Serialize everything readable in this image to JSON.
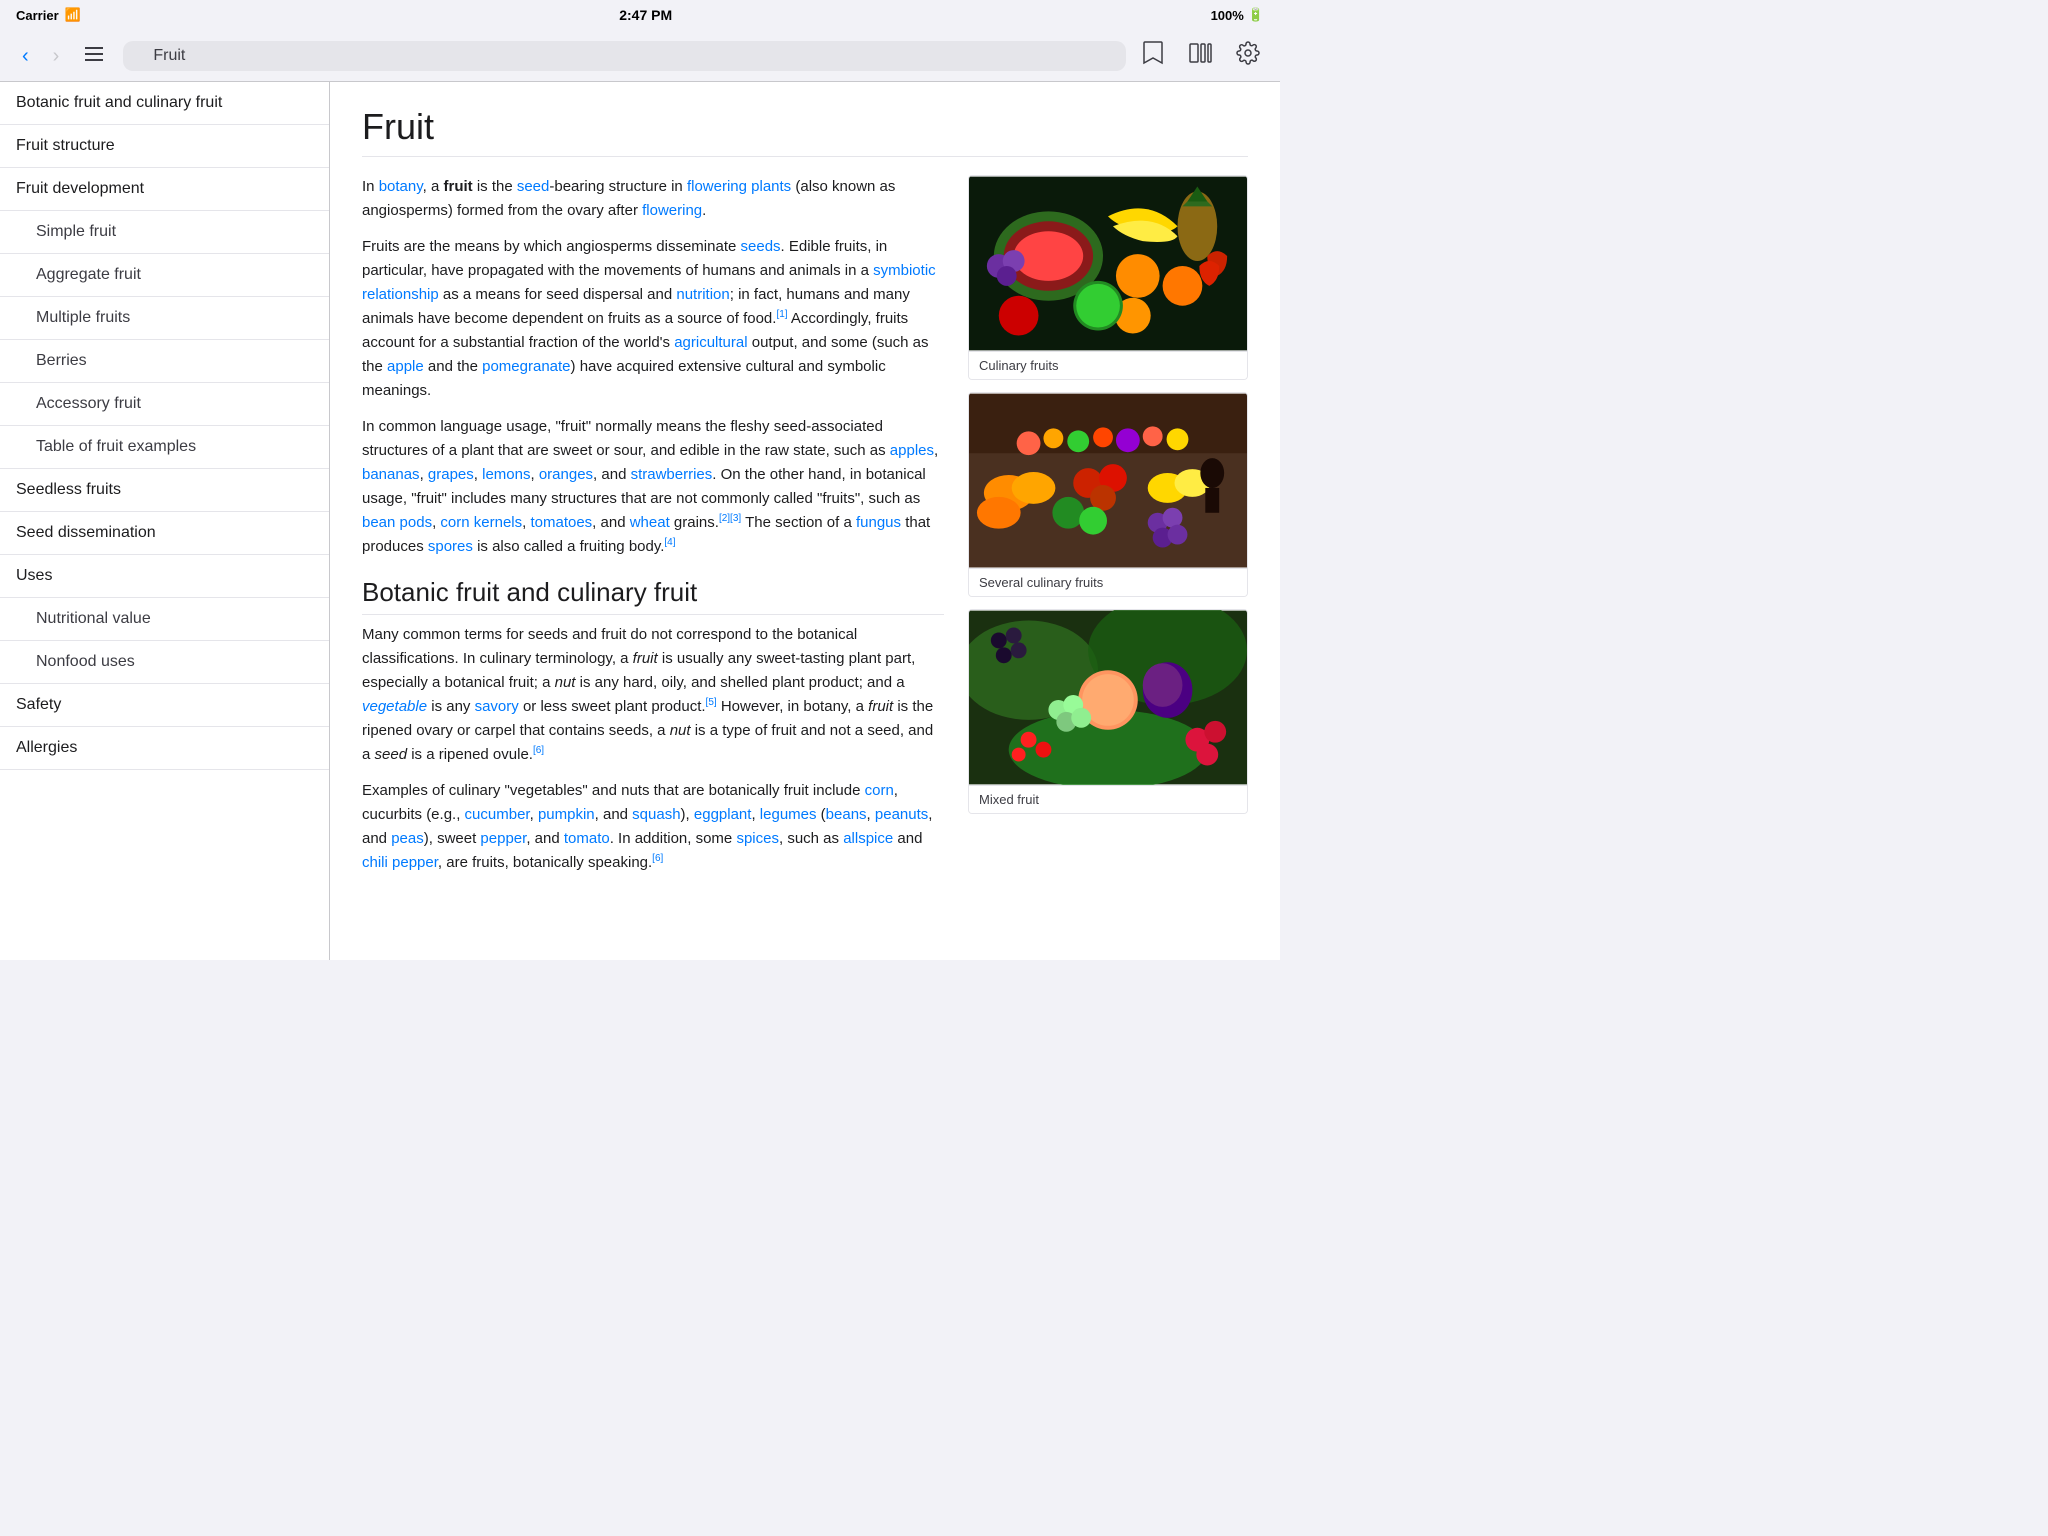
{
  "statusBar": {
    "carrier": "Carrier",
    "time": "2:47 PM",
    "battery": "100%"
  },
  "toolbar": {
    "back_label": "‹",
    "forward_label": "›",
    "toc_label": "☰",
    "search_placeholder": "Fruit",
    "bookmark_label": "☆",
    "library_label": "▦",
    "settings_label": "⚙"
  },
  "sidebar": {
    "items": [
      {
        "label": "Botanic fruit and culinary fruit",
        "indented": false
      },
      {
        "label": "Fruit structure",
        "indented": false
      },
      {
        "label": "Fruit development",
        "indented": false
      },
      {
        "label": "Simple fruit",
        "indented": true
      },
      {
        "label": "Aggregate fruit",
        "indented": true
      },
      {
        "label": "Multiple fruits",
        "indented": true
      },
      {
        "label": "Berries",
        "indented": true
      },
      {
        "label": "Accessory fruit",
        "indented": true
      },
      {
        "label": "Table of fruit examples",
        "indented": true
      },
      {
        "label": "Seedless fruits",
        "indented": false
      },
      {
        "label": "Seed dissemination",
        "indented": false
      },
      {
        "label": "Uses",
        "indented": false
      },
      {
        "label": "Nutritional value",
        "indented": true
      },
      {
        "label": "Nonfood uses",
        "indented": true
      },
      {
        "label": "Safety",
        "indented": false
      },
      {
        "label": "Allergies",
        "indented": false
      }
    ]
  },
  "article": {
    "title": "Fruit",
    "para1_intro": "In ",
    "para1_botany": "botany",
    "para1_mid": ", a ",
    "para1_bold": "fruit",
    "para1_mid2": " is the ",
    "para1_seed": "seed",
    "para1_mid3": "-bearing structure in ",
    "para1_fp": "flowering plants",
    "para1_mid4": " (also known as angiosperms) formed from the ovary after ",
    "para1_fl": "flowering",
    "para1_end": ".",
    "para2": "Fruits are the means by which angiosperms disseminate seeds. Edible fruits, in particular, have propagated with the movements of humans and animals in a symbiotic relationship as a means for seed dispersal and nutrition; in fact, humans and many animals have become dependent on fruits as a source of food.[1] Accordingly, fruits account for a substantial fraction of the world's agricultural output, and some (such as the apple and the pomegranate) have acquired extensive cultural and symbolic meanings.",
    "para3": "In common language usage, \"fruit\" normally means the fleshy seed-associated structures of a plant that are sweet or sour, and edible in the raw state, such as apples, bananas, grapes, lemons, oranges, and strawberries. On the other hand, in botanical usage, \"fruit\" includes many structures that are not commonly called \"fruits\", such as bean pods, corn kernels, tomatoes, and wheat grains.[2][3] The section of a fungus that produces spores is also called a fruiting body.[4]",
    "section1_title": "Botanic fruit and culinary fruit",
    "section1_para1": "Many common terms for seeds and fruit do not correspond to the botanical classifications. In culinary terminology, a fruit is usually any sweet-tasting plant part, especially a botanical fruit; a nut is any hard, oily, and shelled plant product; and a vegetable is any savory or less sweet plant product.[5] However, in botany, a fruit is the ripened ovary or carpel that contains seeds, a nut is a type of fruit and not a seed, and a seed is a ripened ovule.[6]",
    "section1_para2_start": "Examples of culinary \"vegetables\" and nuts that are botanically fruit include ",
    "section1_para2_mid": "corn",
    "section1_para2_rest": ", cucurbits (e.g., cucumber, pumpkin, and squash), eggplant, legumes (beans, peanuts, and peas), sweet pepper, and tomato. In addition, some spices, such as allspice and chili pepper, are fruits, botanically speaking.[6]",
    "images": [
      {
        "caption": "Culinary fruits",
        "type": "fruits-pile"
      },
      {
        "caption": "Several culinary fruits",
        "type": "market"
      },
      {
        "caption": "Mixed fruit",
        "type": "mixed"
      }
    ]
  }
}
